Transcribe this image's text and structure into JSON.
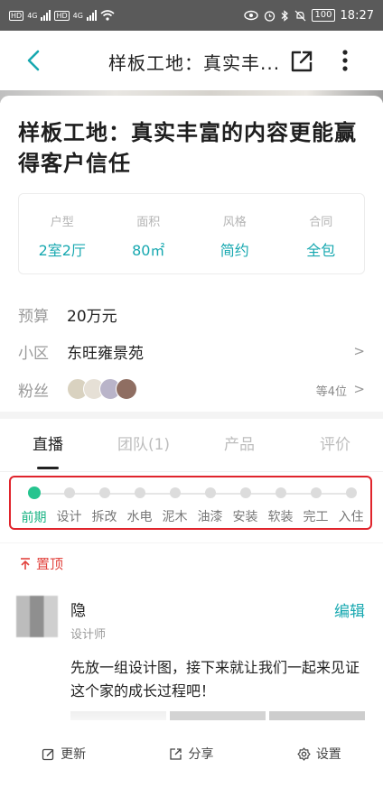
{
  "status_bar": {
    "network_left": "4G",
    "network_right": "4G",
    "battery": "100",
    "time": "18:27"
  },
  "nav": {
    "title": "样板工地：真实丰..."
  },
  "headline": "样板工地：真实丰富的内容更能赢得客户信任",
  "specs": [
    {
      "key": "户型",
      "value": "2室2厅"
    },
    {
      "key": "面积",
      "value": "80㎡"
    },
    {
      "key": "风格",
      "value": "简约"
    },
    {
      "key": "合同",
      "value": "全包"
    }
  ],
  "info": {
    "budget_label": "预算",
    "budget_value": "20万元",
    "community_label": "小区",
    "community_value": "东旺雍景苑",
    "fans_label": "粉丝",
    "fans_count": "等4位"
  },
  "tabs": [
    "直播",
    "团队(1)",
    "产品",
    "评价"
  ],
  "steps": [
    "前期",
    "设计",
    "拆改",
    "水电",
    "泥木",
    "油漆",
    "安装",
    "软装",
    "完工",
    "入住"
  ],
  "current_step": "前期",
  "pin_label": "置顶",
  "post": {
    "author_name": "隐",
    "author_role": "设计师",
    "edit_label": "编辑",
    "text": "先放一组设计图，接下来就让我们一起来见证这个家的成长过程吧！"
  },
  "toolbar": {
    "update": "更新",
    "share": "分享",
    "settings": "设置"
  },
  "colors": {
    "accent": "#17a8b0",
    "active_step": "#26c48f",
    "highlight_frame": "#e0242c",
    "pin": "#e2443f"
  }
}
